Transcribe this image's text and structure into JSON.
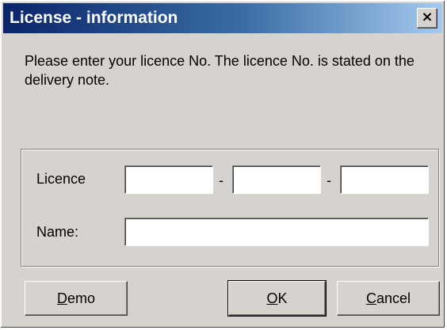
{
  "window": {
    "title": "License - information",
    "close_glyph": "×"
  },
  "message": "Please enter your licence No. The licence No. is stated on the delivery note.",
  "form": {
    "licence_label": "Licence",
    "separator": "-",
    "licence_part1": "",
    "licence_part2": "",
    "licence_part3": "",
    "name_label": "Name:",
    "name_value": ""
  },
  "buttons": {
    "demo": {
      "mnemonic": "D",
      "rest": "emo"
    },
    "ok": {
      "mnemonic": "O",
      "rest": "K"
    },
    "cancel": {
      "mnemonic": "C",
      "rest": "ancel"
    }
  },
  "colors": {
    "titlebar_start": "#0a246a",
    "titlebar_end": "#a6caf0",
    "dialog_bg": "#d6d3ce"
  }
}
